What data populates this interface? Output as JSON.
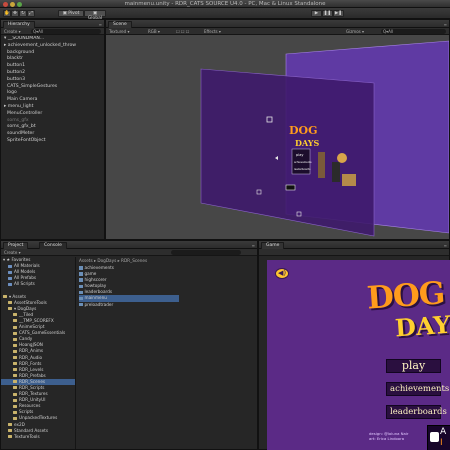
{
  "window": {
    "title": "mainmenu.unity - RDR_CATS SOURCE U4.0 - PC, Mac & Linux Standalone"
  },
  "toolbar": {
    "tools": [
      "hand-icon",
      "move-icon",
      "rotate-icon",
      "scale-icon"
    ],
    "pivot_label": "▣ Pivot",
    "global_label": "▣ Global",
    "play_icon": "▶",
    "pause_icon": "❚❚",
    "step_icon": "▶❚"
  },
  "hierarchy": {
    "tab_label": "Hierarchy",
    "create_label": "Create ▾",
    "search_placeholder": "Q▾All",
    "items": [
      {
        "label": "▾ __SOUNDMAN...",
        "indent": 0,
        "dim": false,
        "selected": false
      },
      {
        "label": "▸ achievement_unlocked_throw",
        "indent": 0,
        "dim": false,
        "selected": false
      },
      {
        "label": "background",
        "indent": 1,
        "dim": false,
        "selected": false
      },
      {
        "label": "blacktr",
        "indent": 1,
        "dim": false,
        "selected": false
      },
      {
        "label": "button1",
        "indent": 1,
        "dim": false,
        "selected": false
      },
      {
        "label": "button2",
        "indent": 1,
        "dim": false,
        "selected": false
      },
      {
        "label": "button3",
        "indent": 1,
        "dim": false,
        "selected": false
      },
      {
        "label": "CATS_SimpleGestures",
        "indent": 1,
        "dim": false,
        "selected": false
      },
      {
        "label": "logo",
        "indent": 1,
        "dim": false,
        "selected": false
      },
      {
        "label": "Main Camera",
        "indent": 1,
        "dim": false,
        "selected": false
      },
      {
        "label": "▸ menu_light",
        "indent": 0,
        "dim": false,
        "selected": false
      },
      {
        "label": "MenuController",
        "indent": 1,
        "dim": false,
        "selected": false
      },
      {
        "label": "soms_gfx",
        "indent": 1,
        "dim": true,
        "selected": false
      },
      {
        "label": "soms_gfx_bt",
        "indent": 1,
        "dim": false,
        "selected": false
      },
      {
        "label": "soundMeter",
        "indent": 1,
        "dim": false,
        "selected": false
      },
      {
        "label": "SpriteFontObject",
        "indent": 1,
        "dim": false,
        "selected": false
      }
    ]
  },
  "scene": {
    "tab_label": "Scene",
    "textured_label": "Textured ▾",
    "rgb_label": "RGB ▾",
    "checkboxes": "☐ ☐ ☐",
    "effects_label": "Effects ▾",
    "gizmos_label": "Gizmos ▾",
    "search_placeholder": "Q▾All",
    "scene_menu_items": [
      "play",
      "achievements",
      "leaderboards"
    ]
  },
  "project": {
    "tab_label": "Project",
    "console_tab_label": "Console",
    "create_label": "Create ▾",
    "tree": [
      {
        "label": "▾ ★ Favorites",
        "folder": "none",
        "sel": false,
        "indent": 0
      },
      {
        "label": "All Materials",
        "folder": "blue",
        "sel": false,
        "indent": 1
      },
      {
        "label": "All Models",
        "folder": "blue",
        "sel": false,
        "indent": 1
      },
      {
        "label": "All Prefabs",
        "folder": "blue",
        "sel": false,
        "indent": 1
      },
      {
        "label": "All Scripts",
        "folder": "blue",
        "sel": false,
        "indent": 1
      },
      {
        "label": "",
        "folder": "none",
        "sel": false,
        "indent": 0
      },
      {
        "label": "▾ Assets",
        "folder": "yellow",
        "sel": false,
        "indent": 0
      },
      {
        "label": "AssetStoreTools",
        "folder": "yellow",
        "sel": false,
        "indent": 1
      },
      {
        "label": "▾ DogDays",
        "folder": "yellow",
        "sel": false,
        "indent": 1
      },
      {
        "label": "__Tiled",
        "folder": "yellow",
        "sel": false,
        "indent": 2
      },
      {
        "label": "__TMP_SCOREFX",
        "folder": "yellow",
        "sel": false,
        "indent": 2
      },
      {
        "label": "AnimeScript",
        "folder": "yellow",
        "sel": false,
        "indent": 2
      },
      {
        "label": "CATS_GameEssentials",
        "folder": "yellow",
        "sel": false,
        "indent": 2
      },
      {
        "label": "Candy",
        "folder": "yellow",
        "sel": false,
        "indent": 2
      },
      {
        "label": "HoangJSON",
        "folder": "yellow",
        "sel": false,
        "indent": 2
      },
      {
        "label": "RDR_Anims",
        "folder": "yellow",
        "sel": false,
        "indent": 2
      },
      {
        "label": "RDR_Audio",
        "folder": "yellow",
        "sel": false,
        "indent": 2
      },
      {
        "label": "RDR_Fonts",
        "folder": "yellow",
        "sel": false,
        "indent": 2
      },
      {
        "label": "RDR_Levels",
        "folder": "yellow",
        "sel": false,
        "indent": 2
      },
      {
        "label": "RDR_Prefabs",
        "folder": "yellow",
        "sel": false,
        "indent": 2
      },
      {
        "label": "RDR_Scenes",
        "folder": "yellow",
        "sel": true,
        "indent": 2
      },
      {
        "label": "RDR_Scripts",
        "folder": "yellow",
        "sel": false,
        "indent": 2
      },
      {
        "label": "RDR_Textures",
        "folder": "yellow",
        "sel": false,
        "indent": 2
      },
      {
        "label": "RDR_UnityUI",
        "folder": "yellow",
        "sel": false,
        "indent": 2
      },
      {
        "label": "Resources",
        "folder": "yellow",
        "sel": false,
        "indent": 2
      },
      {
        "label": "Scripts",
        "folder": "yellow",
        "sel": false,
        "indent": 2
      },
      {
        "label": "UnpackedTextures",
        "folder": "yellow",
        "sel": false,
        "indent": 2
      },
      {
        "label": "ex2D",
        "folder": "yellow",
        "sel": false,
        "indent": 1
      },
      {
        "label": "Standard Assets",
        "folder": "yellow",
        "sel": false,
        "indent": 1
      },
      {
        "label": "TextureTools",
        "folder": "yellow",
        "sel": false,
        "indent": 1
      }
    ],
    "breadcrumb": "Assets ▸ DogDays ▸ RDR_Scenes",
    "files": [
      {
        "label": "achievements",
        "sel": false
      },
      {
        "label": "game",
        "sel": false
      },
      {
        "label": "highscorer",
        "sel": false
      },
      {
        "label": "howtoplay",
        "sel": false
      },
      {
        "label": "leaderboards",
        "sel": false
      },
      {
        "label": "mainmenu",
        "sel": true
      },
      {
        "label": "preloadtrader",
        "sel": false
      }
    ]
  },
  "game": {
    "tab_label": "Game",
    "sound_icon": "◀)",
    "logo_dog": "DOG",
    "logo_days": "DAYS",
    "play_label": "play",
    "achievements_label": "achievements",
    "leaderboards_label": "leaderboards",
    "credits": "design: @loluna Nair\nart: Erica Lindoora",
    "badge_a": "A",
    "badge_i": "I"
  },
  "colors": {
    "scene_purple": "#5a2c9a",
    "game_purple": "#5b2a86",
    "logo_orange": "#ff9b1c",
    "logo_yellow": "#ffcf2f",
    "selection_blue": "#3d5f8e"
  }
}
